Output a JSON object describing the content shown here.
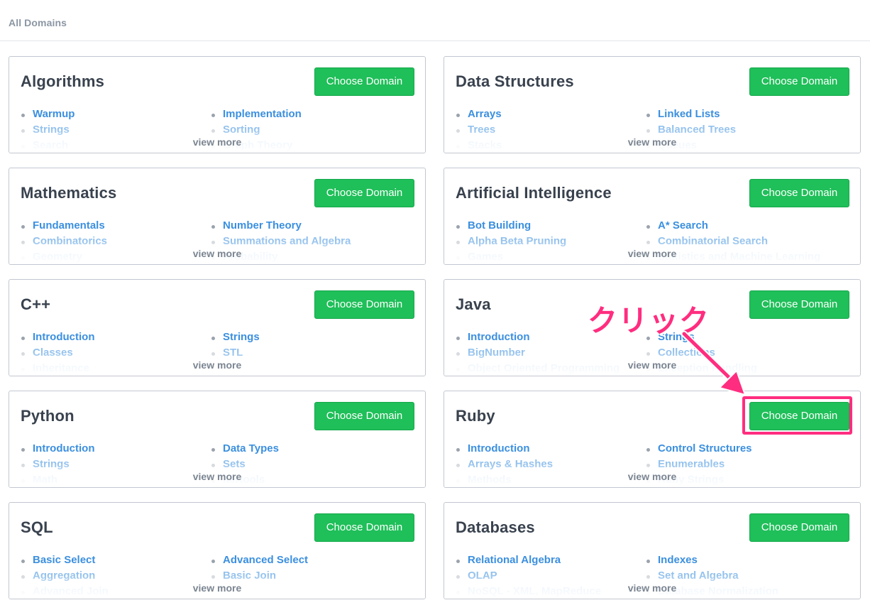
{
  "header": {
    "breadcrumb": "All Domains"
  },
  "button_label": "Choose Domain",
  "view_more_label": "view more",
  "annotation": {
    "text": "クリック",
    "color": "#ff2d7f"
  },
  "colors": {
    "accent_green": "#1fbf59",
    "link_blue": "#3b8fdf",
    "annotation_pink": "#ff2d7f"
  },
  "domains": [
    {
      "title": "Algorithms",
      "topics": [
        "Warmup",
        "Implementation",
        "Strings",
        "Sorting",
        "Search",
        "Graph Theory"
      ]
    },
    {
      "title": "Data Structures",
      "topics": [
        "Arrays",
        "Linked Lists",
        "Trees",
        "Balanced Trees",
        "Stacks",
        "Queues"
      ]
    },
    {
      "title": "Mathematics",
      "topics": [
        "Fundamentals",
        "Number Theory",
        "Combinatorics",
        "Summations and Algebra",
        "Geometry",
        "Probability"
      ]
    },
    {
      "title": "Artificial Intelligence",
      "topics": [
        "Bot Building",
        "A* Search",
        "Alpha Beta Pruning",
        "Combinatorial Search",
        "Games",
        "Statistics and Machine Learning"
      ]
    },
    {
      "title": "C++",
      "topics": [
        "Introduction",
        "Strings",
        "Classes",
        "STL",
        "Inheritance",
        ""
      ]
    },
    {
      "title": "Java",
      "topics": [
        "Introduction",
        "Strings",
        "BigNumber",
        "Collections",
        "Object Oriented Programming",
        "Exception Handling"
      ]
    },
    {
      "title": "Python",
      "topics": [
        "Introduction",
        "Data Types",
        "Strings",
        "Sets",
        "Math",
        "Itertools"
      ]
    },
    {
      "title": "Ruby",
      "topics": [
        "Introduction",
        "Control Structures",
        "Arrays & Hashes",
        "Enumerables",
        "Methods",
        "Ruby Strings"
      ]
    },
    {
      "title": "SQL",
      "topics": [
        "Basic Select",
        "Advanced Select",
        "Aggregation",
        "Basic Join",
        "Advanced Join",
        ""
      ]
    },
    {
      "title": "Databases",
      "topics": [
        "Relational Algebra",
        "Indexes",
        "OLAP",
        "Set and Algebra",
        "NoSQL - XML, MapReduce",
        "Database Normalization"
      ]
    }
  ]
}
